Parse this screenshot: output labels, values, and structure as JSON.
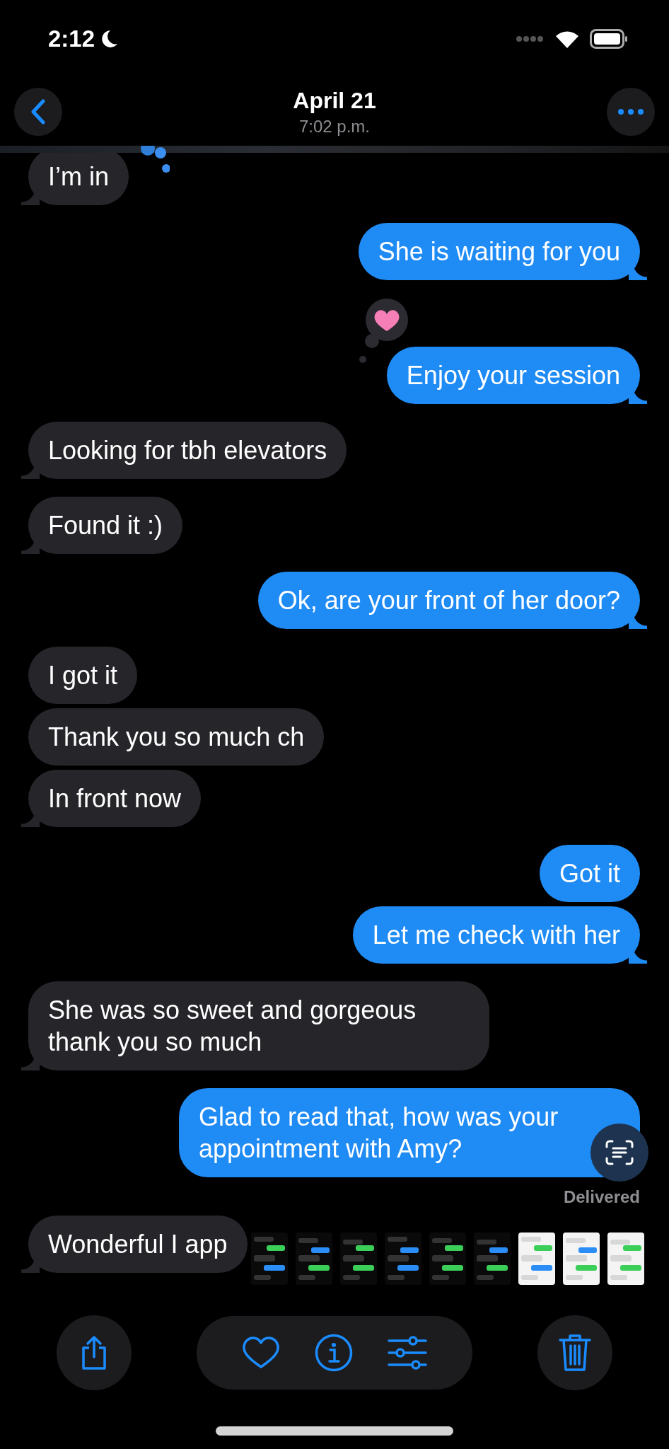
{
  "status_bar": {
    "time": "2:12",
    "focus_mode": true
  },
  "header": {
    "title": "April 21",
    "subtitle": "7:02 p.m."
  },
  "messages": [
    {
      "kind": "received",
      "text": "I’m in",
      "tail": true
    },
    {
      "kind": "sent",
      "text": "She is waiting for you",
      "tail": true
    },
    {
      "kind": "sent",
      "text": "Enjoy your session",
      "tail": true,
      "reaction": {
        "kind": "heart"
      }
    },
    {
      "kind": "received",
      "text": "Looking for tbh elevators",
      "tail": true
    },
    {
      "kind": "received",
      "text": "Found it :)",
      "tail": true
    },
    {
      "kind": "sent",
      "text": "Ok, are your front of her door?",
      "tail": true
    },
    {
      "kind": "received",
      "text": "I got it",
      "tail": false
    },
    {
      "kind": "received",
      "text": "Thank you so much ch",
      "tail": false
    },
    {
      "kind": "received",
      "text": "In front now",
      "tail": true
    },
    {
      "kind": "sent",
      "text": "Got it",
      "tail": false
    },
    {
      "kind": "sent",
      "text": "Let me check with her",
      "tail": true
    },
    {
      "kind": "received",
      "text": "She was so sweet and gorgeous thank you so much",
      "tail": true
    },
    {
      "kind": "sent",
      "text": "Glad to read that, how was your appointment with Amy?",
      "tail": false,
      "receipt": "Delivered",
      "live_text": true
    },
    {
      "kind": "received",
      "text": "Wonderful I app",
      "tail": true
    }
  ]
}
